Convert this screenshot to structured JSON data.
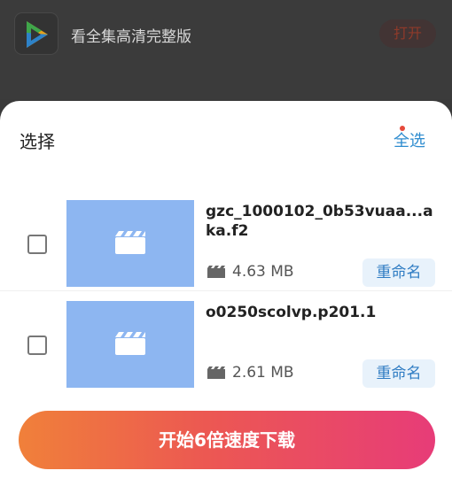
{
  "banner": {
    "app_title": "看全集高清完整版",
    "open_label": "打开",
    "app_icon": "video-play-logo-icon"
  },
  "sheet": {
    "title": "选择",
    "select_all_label": "全选"
  },
  "files": [
    {
      "name": "gzc_1000102_0b53vuaa...aka.f2",
      "size": "4.63 MB",
      "rename_label": "重命名",
      "checked": false,
      "thumb_icon": "clapperboard-icon"
    },
    {
      "name": "o0250scolvp.p201.1",
      "size": "2.61 MB",
      "rename_label": "重命名",
      "checked": false,
      "thumb_icon": "clapperboard-icon"
    }
  ],
  "download_label": "开始6倍速度下载",
  "colors": {
    "thumb": "#8db6f1",
    "accent_blue": "#2f7cc3",
    "gradient_start": "#f0803a",
    "gradient_end": "#e73c78"
  }
}
